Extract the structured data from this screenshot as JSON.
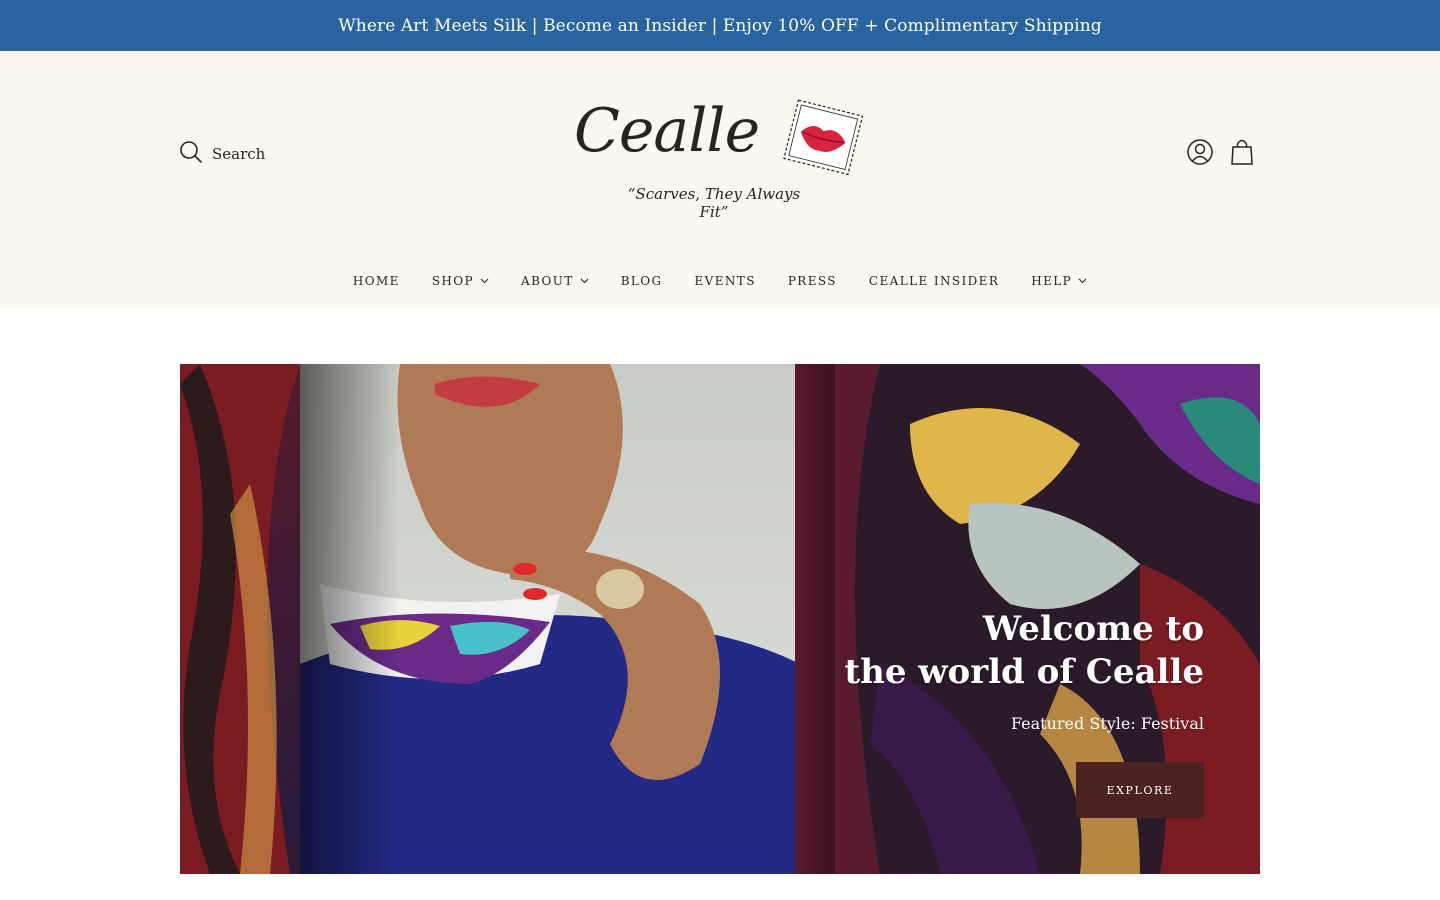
{
  "announcement": {
    "text": "Where Art Meets Silk | Become an Insider | Enjoy 10% OFF + Complimentary Shipping"
  },
  "header": {
    "search_label": "Search",
    "logo_text": "Cealle",
    "logo_tagline": "“Scarves, They Always Fit”",
    "icons": [
      "search-icon",
      "account-icon",
      "cart-icon"
    ]
  },
  "nav": {
    "items": [
      {
        "label": "HOME",
        "dropdown": false
      },
      {
        "label": "SHOP",
        "dropdown": true
      },
      {
        "label": "ABOUT",
        "dropdown": true
      },
      {
        "label": "BLOG",
        "dropdown": false
      },
      {
        "label": "EVENTS",
        "dropdown": false
      },
      {
        "label": "PRESS",
        "dropdown": false
      },
      {
        "label": "CEALLE INSIDER",
        "dropdown": false
      },
      {
        "label": "HELP",
        "dropdown": true
      }
    ]
  },
  "hero": {
    "title_line1": "Welcome to",
    "title_line2": "the world of Cealle",
    "subtitle": "Featured Style: Festival",
    "button_label": "EXPLORE"
  },
  "colors": {
    "announcement_bg": "#2a64a0",
    "header_bg": "#faf8ef",
    "button_bg": "#4a2222",
    "logo_lips": "#d8233f"
  }
}
